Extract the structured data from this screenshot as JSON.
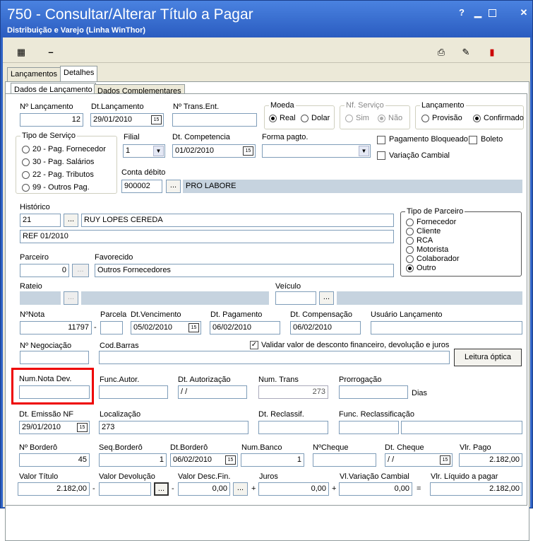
{
  "window": {
    "title": "750 - Consultar/Alterar Título a Pagar",
    "subtitle": "Distribuição e Varejo (Linha WinThor)",
    "help": "?",
    "minimize": "▁",
    "maximize": "□",
    "close": "✕"
  },
  "tabs": {
    "lancamentos": "Lançamentos",
    "detalhes": "Detalhes"
  },
  "subtabs": {
    "dados_lancamento": "Dados de Lançamento",
    "dados_complementares": "Dados Complementares"
  },
  "f": {
    "nlanc_l": "Nº Lançamento",
    "nlanc": "12",
    "dtlanc_l": "Dt.Lançamento",
    "dtlanc": "29/01/2010",
    "ntrans_l": "Nº Trans.Ent.",
    "ntrans": "",
    "moeda_l": "Moeda",
    "real": "Real",
    "dolar": "Dolar",
    "nfserv_l": "Nf. Serviço",
    "sim": "Sim",
    "nao": "Não",
    "lanc_l": "Lançamento",
    "provisao": "Provisão",
    "confirmado": "Confirmado",
    "tiposerv_l": "Tipo de Serviço",
    "ts1": "20 - Pag. Fornecedor",
    "ts2": "30 - Pag. Salários",
    "ts3": "22 - Pag. Tributos",
    "ts4": "99 - Outros Pag.",
    "filial_l": "Filial",
    "filial": "1",
    "dtcomp_l": "Dt. Competencia",
    "dtcomp": "01/02/2010",
    "formapag_l": "Forma pagto.",
    "formapag": "",
    "pagbloq": "Pagamento Bloqueado",
    "boleto": "Boleto",
    "varcamb": "Variação Cambial",
    "contadeb_l": "Conta débito",
    "contadeb": "900002",
    "contadeb_desc": "PRO LABORE",
    "hist_l": "Histórico",
    "hist": "21",
    "hist_desc": "RUY LOPES CEREDA",
    "hist2": "REF 01/2010",
    "tipoparc_l": "Tipo de Parceiro",
    "tp1": "Fornecedor",
    "tp2": "Cliente",
    "tp3": "RCA",
    "tp4": "Motorista",
    "tp5": "Colaborador",
    "tp6": "Outro",
    "parceiro_l": "Parceiro",
    "parceiro": "0",
    "favorecido_l": "Favorecido",
    "favorecido": "Outros Fornecedores",
    "rateio_l": "Rateio",
    "veiculo_l": "Veículo",
    "nnota_l": "NºNota",
    "nnota": "11797",
    "parcela_l": "Parcela",
    "parcela": "",
    "dtvenc_l": "Dt.Vencimento",
    "dtvenc": "05/02/2010",
    "dtpag_l": "Dt. Pagamento",
    "dtpag": "06/02/2010",
    "dtcomp2_l": "Dt. Compensação",
    "dtcomp2": "06/02/2010",
    "usulanc_l": "Usuário Lançamento",
    "nneg_l": "Nº Negociação",
    "codbarras_l": "Cod.Barras",
    "validar": "Validar valor de desconto financeiro,  devolução e juros",
    "leitura": "Leitura óptica",
    "numnotadev_l": "Num.Nota Dev.",
    "funcautor_l": "Func.Autor.",
    "dtautor_l": "Dt. Autorização",
    "dtautor": " / /",
    "numtrans_l": "Num. Trans",
    "numtrans": "273",
    "prorrog_l": "Prorrogação",
    "dias": "Dias",
    "dtemis_l": "Dt. Emissão NF",
    "dtemis": "29/01/2010",
    "local_l": "Localização",
    "local": "273",
    "dtreclass_l": "Dt. Reclassif.",
    "funcreclass_l": "Func. Reclassificação",
    "nbord_l": "Nº Borderô",
    "nbord": "45",
    "seqbord_l": "Seq.Borderô",
    "seqbord": "1",
    "dtbord_l": "Dt.Borderô",
    "dtbord": "06/02/2010",
    "numbanco_l": "Num.Banco",
    "numbanco": "1",
    "ncheque_l": "NºCheque",
    "dtcheque_l": "Dt. Cheque",
    "dtcheque": " / /",
    "vlpago_l": "Vlr. Pago",
    "vlpago": "2.182,00",
    "vltit_l": "Valor Título",
    "vltit": "2.182,00",
    "vldev_l": "Valor Devolução",
    "vldev": "",
    "vldesc_l": "Valor Desc.Fin.",
    "vldesc": "0,00",
    "juros_l": "Juros",
    "juros": "0,00",
    "vlvar_l": "Vl.Variação Cambial",
    "vlvar": "0,00",
    "vlliq_l": "Vlr. Líquido a pagar",
    "vlliq": "2.182,00",
    "minus": "-",
    "plus": "+",
    "eq": "=",
    "dots": "...",
    "check": "✓",
    "cal": "15",
    "arrow": "▼"
  }
}
